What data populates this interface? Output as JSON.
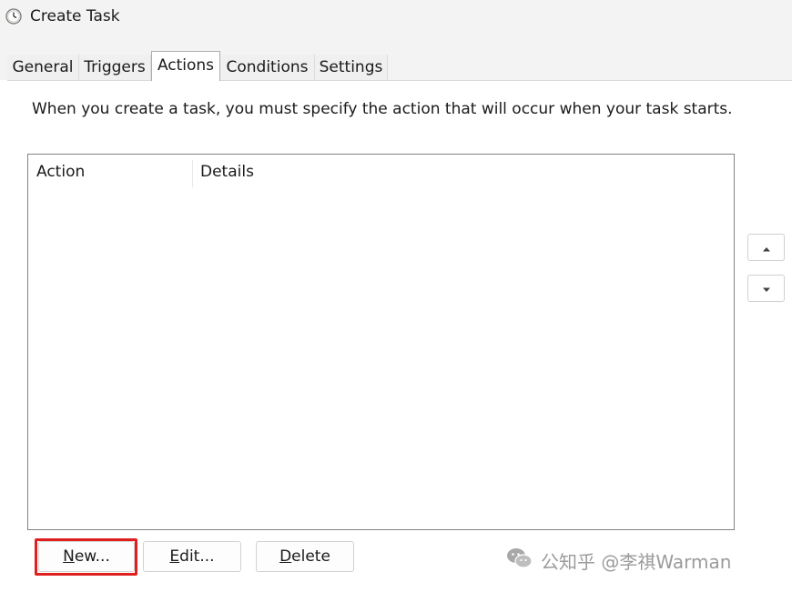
{
  "window": {
    "title": "Create Task",
    "icon": "clock-icon"
  },
  "tabs": [
    {
      "label": "General",
      "active": false
    },
    {
      "label": "Triggers",
      "active": false
    },
    {
      "label": "Actions",
      "active": true
    },
    {
      "label": "Conditions",
      "active": false
    },
    {
      "label": "Settings",
      "active": false
    }
  ],
  "actions_tab": {
    "instruction": "When you create a task, you must specify the action that will occur when your task starts.",
    "columns": [
      "Action",
      "Details"
    ],
    "rows": [],
    "move_up_icon": "triangle-up-icon",
    "move_down_icon": "triangle-down-icon",
    "buttons": {
      "new": {
        "mnemonic": "N",
        "rest": "ew..."
      },
      "edit": {
        "mnemonic": "E",
        "rest": "dit..."
      },
      "delete": {
        "mnemonic": "D",
        "rest": "elete"
      }
    }
  },
  "annotation": {
    "highlight_color": "#e0201f",
    "highlight_target": "new-button"
  },
  "watermark": {
    "text": "公知乎 @李祺Warman",
    "icon": "wechat-icon"
  }
}
